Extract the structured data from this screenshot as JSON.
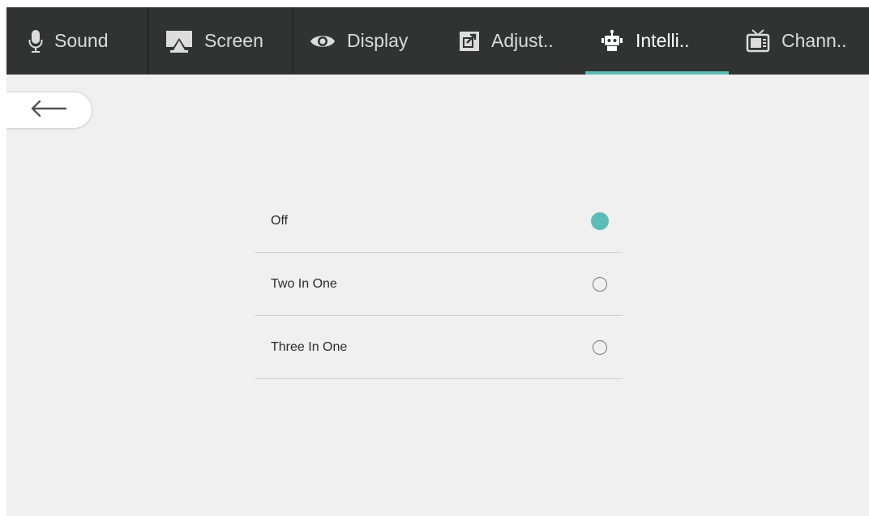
{
  "colors": {
    "accent": "#5cbcb7",
    "tabbar_bg": "#313232",
    "content_bg": "#eff0ef"
  },
  "tabs": [
    {
      "label": "Sound",
      "icon": "microphone-icon",
      "active": false
    },
    {
      "label": "Screen",
      "icon": "screen-cast-icon",
      "active": false
    },
    {
      "label": "Display",
      "icon": "eye-icon",
      "active": false
    },
    {
      "label": "Adjust..",
      "icon": "external-adjust-icon",
      "active": false
    },
    {
      "label": "Intelli..",
      "icon": "robot-icon",
      "active": true
    },
    {
      "label": "Chann..",
      "icon": "tv-icon",
      "active": false
    }
  ],
  "back_button": {
    "icon": "arrow-left-icon"
  },
  "options": [
    {
      "label": "Off",
      "selected": true
    },
    {
      "label": "Two In One",
      "selected": false
    },
    {
      "label": "Three In One",
      "selected": false
    }
  ]
}
